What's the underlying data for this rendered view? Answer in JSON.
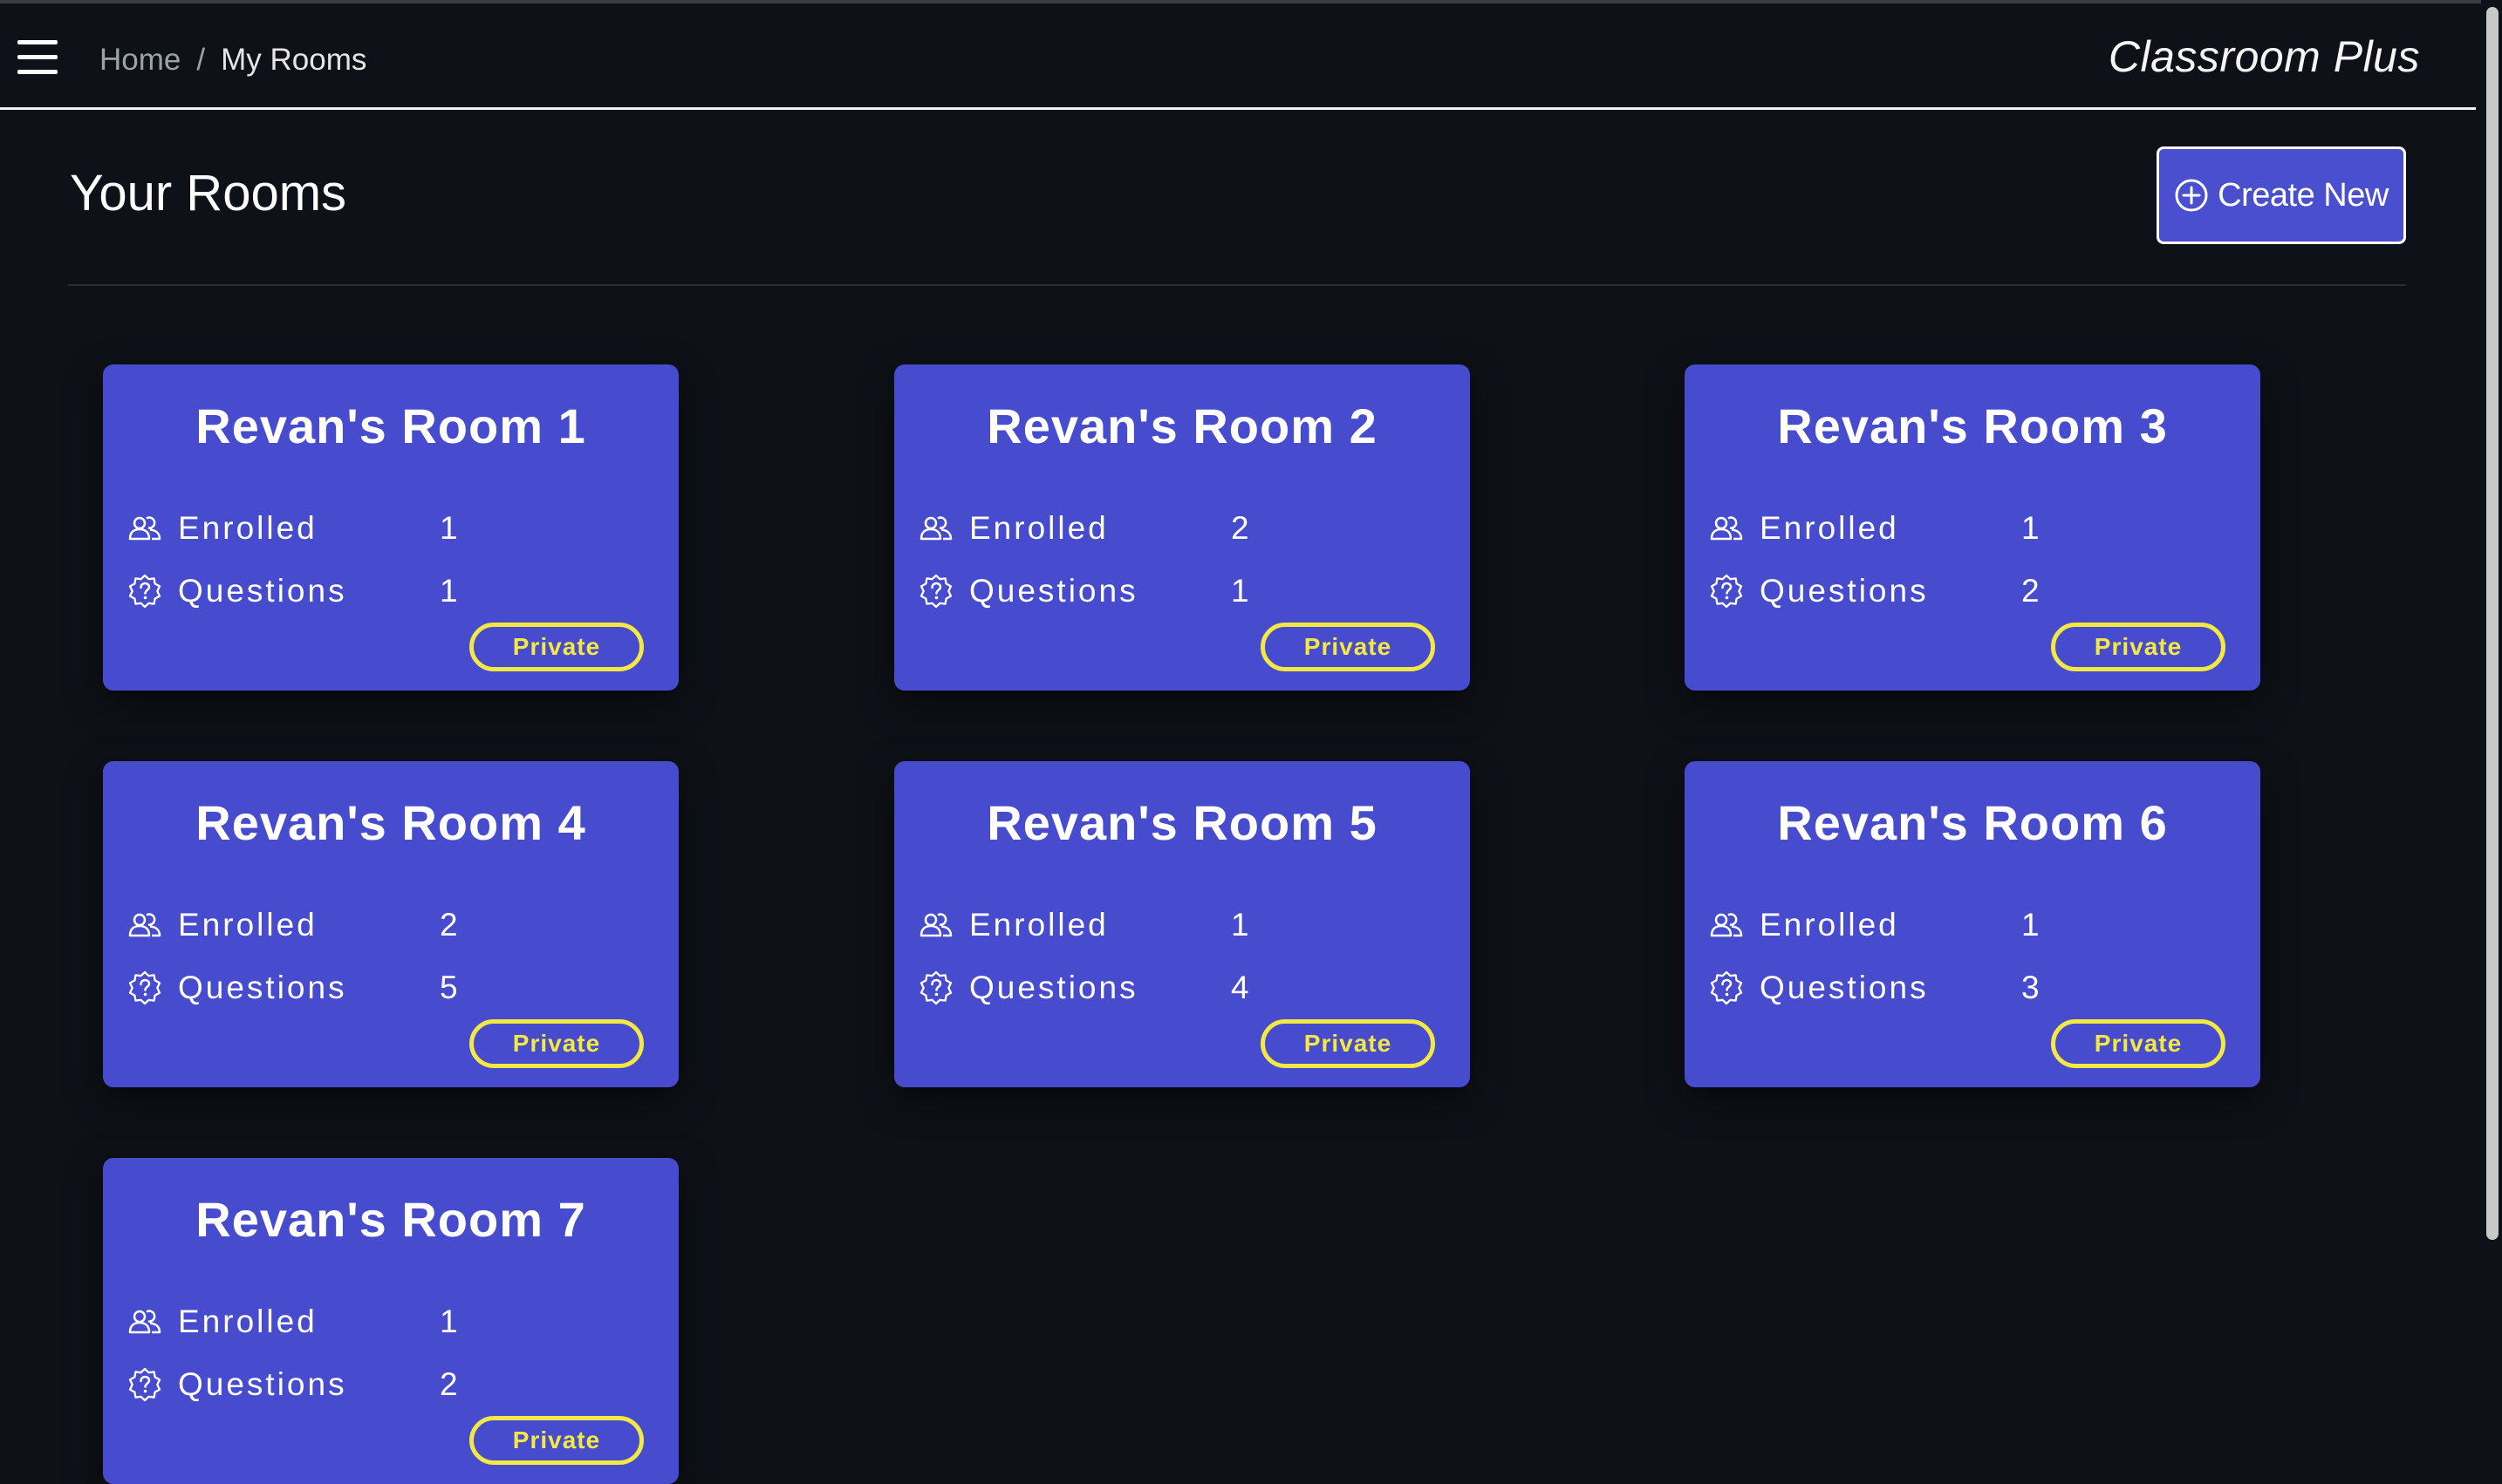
{
  "nav": {
    "breadcrumb_home": "Home",
    "breadcrumb_sep": "/",
    "breadcrumb_current": "My Rooms",
    "brand": "Classroom Plus"
  },
  "page": {
    "title": "Your Rooms",
    "create_label": "Create New"
  },
  "labels": {
    "enrolled": "Enrolled",
    "questions": "Questions"
  },
  "rooms": [
    {
      "name": "Revan's Room 1",
      "enrolled": "1",
      "questions": "1",
      "visibility": "Private"
    },
    {
      "name": "Revan's Room 2",
      "enrolled": "2",
      "questions": "1",
      "visibility": "Private"
    },
    {
      "name": "Revan's Room 3",
      "enrolled": "1",
      "questions": "2",
      "visibility": "Private"
    },
    {
      "name": "Revan's Room 4",
      "enrolled": "2",
      "questions": "5",
      "visibility": "Private"
    },
    {
      "name": "Revan's Room 5",
      "enrolled": "1",
      "questions": "4",
      "visibility": "Private"
    },
    {
      "name": "Revan's Room 6",
      "enrolled": "1",
      "questions": "3",
      "visibility": "Private"
    },
    {
      "name": "Revan's Room 7",
      "enrolled": "1",
      "questions": "2",
      "visibility": "Private"
    }
  ],
  "colors": {
    "background": "#0e1117",
    "card": "#474cce",
    "badge": "#f4e842",
    "button": "#4a4fcf"
  },
  "icons": {
    "menu": "hamburger-menu-icon",
    "create": "plus-circle-icon",
    "enrolled": "people-icon",
    "questions": "question-badge-icon"
  }
}
